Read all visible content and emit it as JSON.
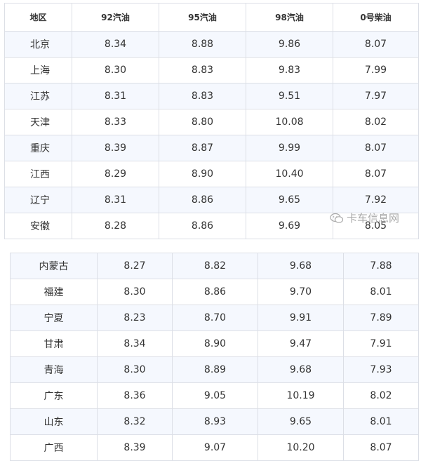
{
  "table1": {
    "headers": [
      "地区",
      "92汽油",
      "95汽油",
      "98汽油",
      "0号柴油"
    ],
    "rows": [
      [
        "北京",
        "8.34",
        "8.88",
        "9.86",
        "8.07"
      ],
      [
        "上海",
        "8.30",
        "8.83",
        "9.83",
        "7.99"
      ],
      [
        "江苏",
        "8.31",
        "8.83",
        "9.51",
        "7.97"
      ],
      [
        "天津",
        "8.33",
        "8.80",
        "10.08",
        "8.02"
      ],
      [
        "重庆",
        "8.39",
        "8.87",
        "9.99",
        "8.07"
      ],
      [
        "江西",
        "8.29",
        "8.90",
        "10.40",
        "8.07"
      ],
      [
        "辽宁",
        "8.31",
        "8.86",
        "9.65",
        "7.92"
      ],
      [
        "安徽",
        "8.28",
        "8.86",
        "9.69",
        "8.05"
      ]
    ]
  },
  "table2": {
    "rows": [
      [
        "内蒙古",
        "8.27",
        "8.82",
        "9.68",
        "7.88"
      ],
      [
        "福建",
        "8.30",
        "8.86",
        "9.70",
        "8.01"
      ],
      [
        "宁夏",
        "8.23",
        "8.70",
        "9.91",
        "7.89"
      ],
      [
        "甘肃",
        "8.34",
        "8.90",
        "9.47",
        "7.91"
      ],
      [
        "青海",
        "8.30",
        "8.89",
        "9.68",
        "7.93"
      ],
      [
        "广东",
        "8.36",
        "9.05",
        "10.19",
        "8.02"
      ],
      [
        "山东",
        "8.32",
        "8.93",
        "9.65",
        "8.01"
      ],
      [
        "广西",
        "8.39",
        "9.07",
        "10.20",
        "8.07"
      ]
    ]
  },
  "watermark": {
    "text": "卡车信息网",
    "icon": "wechat-icon"
  }
}
